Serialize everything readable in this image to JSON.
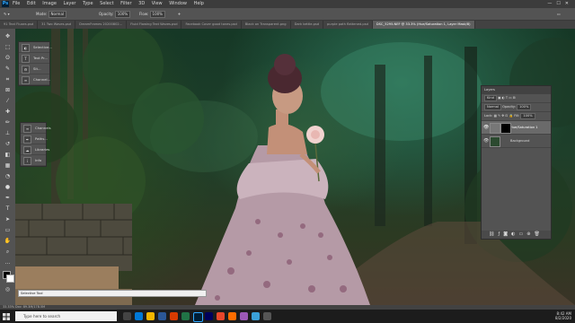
{
  "app": {
    "logo": "Ps"
  },
  "menu": [
    "File",
    "Edit",
    "Image",
    "Layer",
    "Type",
    "Select",
    "Filter",
    "3D",
    "View",
    "Window",
    "Help"
  ],
  "window_controls": [
    "—",
    "☐",
    "✕"
  ],
  "options": {
    "mode_label": "Mode:",
    "mode_value": "Normal",
    "opacity_label": "Opacity:",
    "opacity_value": "100%",
    "flow_label": "Flow:",
    "flow_value": "100%"
  },
  "tabs": [
    "91 Text Fluxes.psd",
    "31 Two Waves.psd",
    "DreamFrames 20200802...",
    "Fluid Flowing Text Waves.psd",
    "Facebook Cover good tones.psd",
    "Black on Transparent.png",
    "Dark kettle.psd",
    "purple path flattened.psd",
    "DSC_5295.NEF @ 33.3% (Hue/Saturation 1, Layer Mask/8)"
  ],
  "active_tab_index": 8,
  "mini_panel_1": [
    "Selective...",
    "Text Pr...",
    "Sit...",
    "Channel..."
  ],
  "mini_panel_2": [
    "Channels",
    "Paths...",
    "Libraries",
    "Info"
  ],
  "layers": {
    "title": "Layers",
    "kind_label": "Kind",
    "blend_mode": "Normal",
    "opacity_label": "Opacity:",
    "opacity_value": "100%",
    "lock_label": "Lock:",
    "fill_label": "Fill:",
    "fill_value": "100%",
    "items": [
      {
        "name": "Hue/Saturation 1",
        "selected": true
      },
      {
        "name": "Background",
        "selected": false
      }
    ],
    "footer_icons": [
      "link-icon",
      "fx-icon",
      "mask-icon",
      "adjustment-icon",
      "folder-icon",
      "new-layer-icon",
      "trash-icon"
    ]
  },
  "tooltip_text": "Selective Tool",
  "status_text": "33.33%    Doc: 89.3M/178.5M",
  "taskbar": {
    "search_placeholder": "Type here to search",
    "time": "8:42 AM",
    "date": "8/2/2020"
  },
  "colors": {
    "foliage_dark": "#163826",
    "dress": "#b59aa6",
    "accent_blue": "#31a8ff"
  }
}
